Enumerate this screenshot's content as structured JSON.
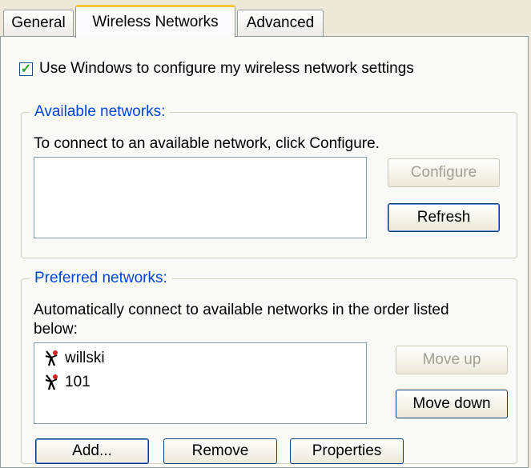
{
  "tabs": [
    "General",
    "Wireless Networks",
    "Advanced"
  ],
  "use_windows": {
    "checked": true,
    "label": "Use Windows to configure my wireless network settings"
  },
  "available": {
    "title": "Available networks:",
    "instruction": "To connect to an available network, click Configure.",
    "configure_label": "Configure",
    "refresh_label": "Refresh"
  },
  "preferred": {
    "title": "Preferred networks:",
    "instruction_line1": "Automatically connect to available networks in the order listed",
    "instruction_line2": "below:",
    "networks": [
      "willski",
      "101"
    ],
    "move_up_label": "Move up",
    "move_down_label": "Move down"
  },
  "bottom": {
    "add_label": "Add...",
    "remove_label": "Remove",
    "properties_label": "Properties"
  },
  "icons": {
    "checkbox": "checkmark-icon",
    "network": "wireless-network-icon"
  }
}
